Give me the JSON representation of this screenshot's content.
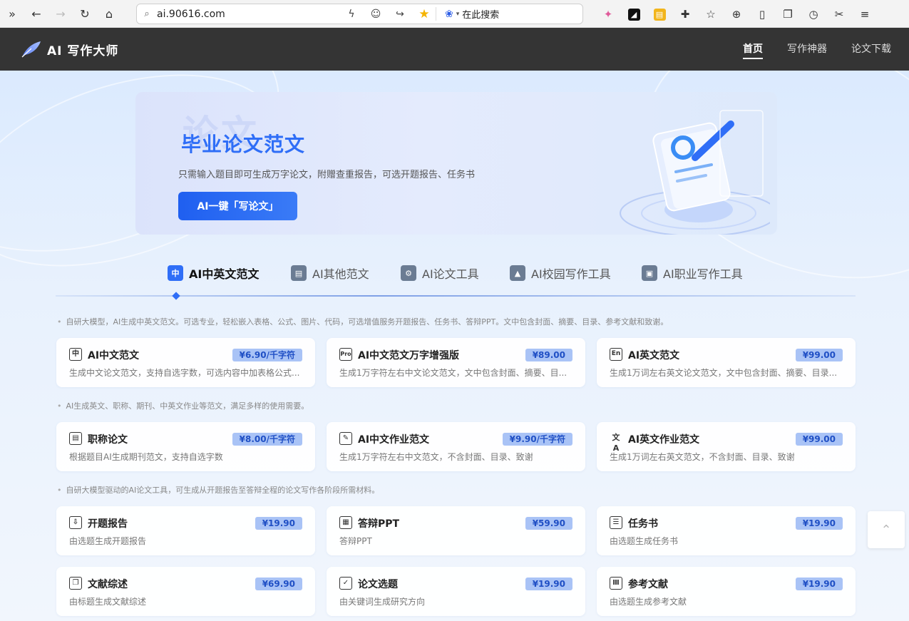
{
  "browser": {
    "url": "ai.90616.com",
    "search_engine_label": "在此搜索"
  },
  "header": {
    "logo_text": "AI 写作大师",
    "nav": [
      {
        "label": "首页",
        "active": true
      },
      {
        "label": "写作神器",
        "active": false
      },
      {
        "label": "论文下载",
        "active": false
      }
    ]
  },
  "banner": {
    "ghost_text": "论文",
    "title": "毕业论文范文",
    "subtitle": "只需输入题目即可生成万字论文，附赠查重报告，可选开题报告、任务书",
    "button_label": "AI一键「写论文」"
  },
  "tabs": [
    {
      "label": "AI中英文范文",
      "icon": "zh-en-icon",
      "active": true
    },
    {
      "label": "AI其他范文",
      "icon": "document-stack-icon",
      "active": false
    },
    {
      "label": "AI论文工具",
      "icon": "ai-gear-icon",
      "active": false
    },
    {
      "label": "AI校园写作工具",
      "icon": "graduation-cap-icon",
      "active": false
    },
    {
      "label": "AI职业写作工具",
      "icon": "briefcase-icon",
      "active": false
    }
  ],
  "sections": [
    {
      "note": "自研大模型，AI生成中英文范文。可选专业，轻松嵌入表格、公式、图片、代码，可选增值服务开题报告、任务书、答辩PPT。文中包含封面、摘要、目录、参考文献和致谢。",
      "cards": [
        {
          "title": "AI中文范文",
          "price": "¥6.90/千字符",
          "desc": "生成中文论文范文，支持自选字数，可选内容中加表格公式...",
          "icon": "chinese-char-icon",
          "glyph": "中"
        },
        {
          "title": "AI中文范文万字增强版",
          "price": "¥89.00",
          "desc": "生成1万字符左右中文论文范文，文中包含封面、摘要、目...",
          "icon": "pro-badge-icon",
          "glyph": "Pro"
        },
        {
          "title": "AI英文范文",
          "price": "¥99.00",
          "desc": "生成1万词左右英文论文范文，文中包含封面、摘要、目录...",
          "icon": "english-badge-icon",
          "glyph": "En"
        }
      ]
    },
    {
      "note": "AI生成英文、职称、期刊、中英文作业等范文，满足多样的使用需要。",
      "cards": [
        {
          "title": "职称论文",
          "price": "¥8.00/千字符",
          "desc": "根据题目AI生成期刊范文，支持自选字数",
          "icon": "book-icon",
          "glyph": "▤"
        },
        {
          "title": "AI中文作业范文",
          "price": "¥9.90/千字符",
          "desc": "生成1万字符左右中文范文，不含封面、目录、致谢",
          "icon": "edit-document-icon",
          "glyph": "✎"
        },
        {
          "title": "AI英文作业范文",
          "price": "¥99.00",
          "desc": "生成1万词左右英文范文，不含封面、目录、致谢",
          "icon": "translate-icon",
          "glyph": "文A"
        }
      ]
    },
    {
      "note": "自研大模型驱动的AI论文工具，可生成从开题报告至答辩全程的论文写作各阶段所需材料。",
      "cards": [
        {
          "title": "开题报告",
          "price": "¥19.90",
          "desc": "由选题生成开题报告",
          "icon": "report-tray-icon",
          "glyph": "⇩"
        },
        {
          "title": "答辩PPT",
          "price": "¥59.90",
          "desc": "答辩PPT",
          "icon": "ppt-icon",
          "glyph": "▦"
        },
        {
          "title": "任务书",
          "price": "¥19.90",
          "desc": "由选题生成任务书",
          "icon": "task-list-icon",
          "glyph": "☰"
        }
      ]
    },
    {
      "note": "",
      "cards": [
        {
          "title": "文献综述",
          "price": "¥69.90",
          "desc": "由标题生成文献综述",
          "icon": "open-book-icon",
          "glyph": "❐"
        },
        {
          "title": "论文选题",
          "price": "¥19.90",
          "desc": "由关键词生成研究方向",
          "icon": "checklist-icon",
          "glyph": "✓"
        },
        {
          "title": "参考文献",
          "price": "¥19.90",
          "desc": "由选题生成参考文献",
          "icon": "library-icon",
          "glyph": "Ⅲ"
        }
      ]
    }
  ],
  "backtop_label": "⌃"
}
